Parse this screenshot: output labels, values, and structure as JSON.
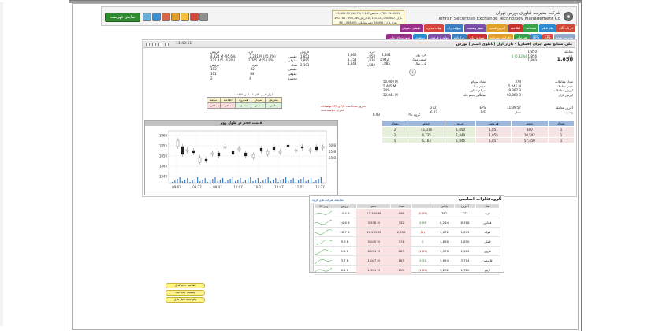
{
  "header": {
    "org_fa": "شرکت مدیریت فناوری بورس تهران",
    "org_en": "Tehran Securities Exchange Technology Management Co",
    "show_list_label": "نمایش فهرست",
    "index_lines": [
      "شاخص 2,147 (0.75%) 25,405.35 -  TSE: 11:40:51",
      "ارزش  بازار  : 10,153,123,000,000  ارزش  900,180  -  390.784 M",
      "تعداد   بازار  : 16,496   حجم  معاملات  1,038,491 86"
    ],
    "tool_icon_colors": [
      "#6aaed6",
      "#3d8fcf",
      "#d9664a",
      "#e0a02a",
      "#f2c33a",
      "#d4453b",
      "#8f8f8f"
    ]
  },
  "nav": {
    "row1": [
      {
        "label": "در یک نگاه",
        "color": "#d04b3a"
      },
      {
        "label": "پیام ناظر",
        "color": "#2d8ad0"
      },
      {
        "label": "سه‌ماهه",
        "color": "#37a24a"
      },
      {
        "label": "اطلاعیه",
        "color": "#c9322d"
      },
      {
        "label": "آخرین قیمت",
        "color": "#e0a02a"
      },
      {
        "label": "تغییر وضعیت",
        "color": "#7b4fa8"
      },
      {
        "label": "سهامداران",
        "color": "#3a7fc4"
      },
      {
        "label": "هیات مدیره",
        "color": "#d4453b"
      },
      {
        "label": "حقیقی-حقوقی",
        "color": "#9a2f8a"
      }
    ],
    "row2": [
      {
        "label": "مدیریت شده",
        "color": "#8fa8c8"
      },
      {
        "label": "EPS",
        "color": "#d04b3a"
      },
      {
        "label": "DPS",
        "color": "#2d8ad0"
      },
      {
        "label": "همزمانی",
        "color": "#37a24a"
      },
      {
        "label": "افزایش سرمایه",
        "color": "#e0a02a"
      },
      {
        "label": "سود و زیان",
        "color": "#c9322d"
      },
      {
        "label": "ترازنامه",
        "color": "#3a7fc4"
      },
      {
        "label": "تولید و فروش",
        "color": "#7b4fa8"
      },
      {
        "label": "پرتفوی",
        "color": "#2d8ad0"
      },
      {
        "label": "صورت‌های مالی",
        "color": "#9a2f8a"
      }
    ]
  },
  "panel": {
    "title": "ملی صنایع مس ایران (فملی) - بازار اول (تابلوی اصلی) بورس",
    "clock": "11:40:51",
    "right_col": {
      "labels": [
        "معامله",
        "پایانی",
        "اولین",
        "",
        "تعداد معاملات",
        "حجم معاملات",
        "ارزش معاملات",
        "ارزش بازار",
        "",
        "آخرین معامله",
        "وضعیت"
      ],
      "last_trade": "1,850",
      "last_trade_prev": "1,850",
      "final": "1,856",
      "final_change": "(0.32%)",
      "final_delta": "6",
      "first": "1,860",
      "trades_count": "374",
      "trades_volume": "5.045 M",
      "trades_value": "9.367 B",
      "market_value": "92,860 B",
      "last_time": "11:39:57",
      "status": "مجاز"
    },
    "col2": {
      "labels": [
        "بازه روز",
        "قیمت مجاز",
        "بازه سال"
      ],
      "values": [
        [
          "1,841",
          "1,866"
        ],
        [
          "1,942",
          "1,758"
        ],
        [
          "1,885",
          "1,843"
        ]
      ],
      "mid_labels": [
        "تعداد سهام",
        "حجم مبنا",
        "سهام شناور",
        "میانگین حجم ماه"
      ],
      "mid_values": [
        "50,000 M",
        "5.405 M",
        "24%",
        "22,841 M"
      ],
      "eps_label": "EPS",
      "eps_value": "272",
      "pe_label": "P/E",
      "pe_value": "6.82",
      "pe_group_label": "P/E گروه",
      "pe_group_value": "6.93",
      "buy_label": "خرید",
      "sell_label": "فروش",
      "b1": "1,850",
      "s1": "1,851",
      "b2": "1,836",
      "s2": "1,885",
      "b3": "1,582",
      "s3": "2,191"
    },
    "left_col": {
      "buy_label": "خرید",
      "sell_label": "فروش",
      "rows": [
        {
          "label": "حقیقی",
          "buy": "2.281 M (45.2%)",
          "sell": "4.824 M (95.6%)"
        },
        {
          "label": "حقوقی",
          "buy": "2.765 M (54.8%)",
          "sell": "221,445 (4.3%)"
        },
        {
          "label": "تعداد",
          "buy": "",
          "sell": ""
        }
      ],
      "count_labels": [
        "خرید",
        "فروش"
      ],
      "counts": [
        {
          "label": "حقیقی",
          "buy": "92",
          "sell": "103"
        },
        {
          "label": "حقوقی",
          "buy": "84",
          "sell": "101"
        },
        {
          "label": "مجموع",
          "buy": "4",
          "sell": "2"
        }
      ]
    },
    "action_note": "ابزار تغییر مکان با نمایش اطلاعات",
    "action_table": {
      "row1": [
        "سابقه",
        "اطلاعیه",
        "همگروه",
        "نمودار",
        "سفارش"
      ],
      "row2": [
        "مخفی",
        "مخفی",
        "نمایش",
        "نمایش",
        "نمایش"
      ]
    },
    "notice_1": "توضیحات EPS و P/E به روز شده است",
    "notice_2": "ناشران خواسته شده",
    "notice_3": "در اطلاعات ارائه شده است"
  },
  "order_book": {
    "headers": [
      "تعداد",
      "حجم",
      "خرید",
      "فروش",
      "حجم",
      "تعداد"
    ],
    "rows": [
      [
        "2",
        "41,316",
        "1,850",
        "1,851",
        "800",
        "1"
      ],
      [
        "2",
        "4,735",
        "1,849",
        "1,855",
        "10,502",
        "1"
      ],
      [
        "5",
        "6,163",
        "1,846",
        "1,857",
        "57,450",
        "1"
      ]
    ]
  },
  "chart": {
    "title": "قیمت حجم در طول روز",
    "x_ticks": [
      "09:07",
      "09:27",
      "09:47",
      "10:07",
      "10:27",
      "10:47",
      "11:07",
      "11:27"
    ],
    "y_ticks": [
      "1860",
      "1855",
      "1850",
      "1845",
      "1840"
    ],
    "vol_ticks": [
      "60 B",
      "55 B",
      "50 B"
    ]
  },
  "lower": {
    "title": "گروه:فلزات اساسی",
    "subtitle": "مقایسه شرکت های گروه",
    "headers": [
      "نماد",
      "آخرین",
      "پایانی",
      "",
      "تعداد",
      "حجم",
      "ارزش",
      "30 روز"
    ],
    "rows": [
      {
        "symbol": "ذوب",
        "last": "777",
        "final": "782",
        "chg": "(0.09)",
        "cnt": "958",
        "vol": "13.359 M",
        "val": "10.4 B",
        "chgclass": "red"
      },
      {
        "symbol": "فخاس",
        "last": "6,318",
        "final": "6,264",
        "chg": "3.93",
        "cnt": "742",
        "vol": "3.936 M",
        "val": "24.6 B",
        "chgclass": "green"
      },
      {
        "symbol": "فولاد",
        "last": "1,675",
        "final": "1,672",
        "chg": "(1)",
        "cnt": "2,556",
        "vol": "17.205 M",
        "val": "28.7 B",
        "chgclass": "red"
      },
      {
        "symbol": "فملی",
        "last": "1,850",
        "final": "1,856",
        "chg": "0",
        "cnt": "374",
        "vol": "5.045 M",
        "val": "9.3 B",
        "chgclass": "green"
      },
      {
        "symbol": "فروی",
        "last": "1,589",
        "final": "1,576",
        "chg": "(1.65)",
        "cnt": "683",
        "vol": "6.091 M",
        "val": "9.6 B",
        "chgclass": "red"
      },
      {
        "symbol": "فاسمین",
        "last": "3,714",
        "final": "3,694",
        "chg": "3.31",
        "cnt": "163",
        "vol": "1.007 M",
        "val": "3.7 B",
        "chgclass": "green"
      },
      {
        "symbol": "ارفع",
        "last": "1,720",
        "final": "3,232",
        "chg": "(1.89)",
        "cnt": "229",
        "vol": "1.901 M",
        "val": "6.1 B",
        "chgclass": "red"
      }
    ]
  },
  "side_buttons": [
    "اطلاعیه جدید کدال",
    "وضعیت جدید نماد",
    "پیام جدید ناظر بازار"
  ],
  "colors": {
    "buy_bg": "#e6efd9",
    "sell_bg": "#f6e3e3",
    "header_blue": "#9fb8d9",
    "green": "#1a8a1a",
    "red": "#c01515"
  }
}
